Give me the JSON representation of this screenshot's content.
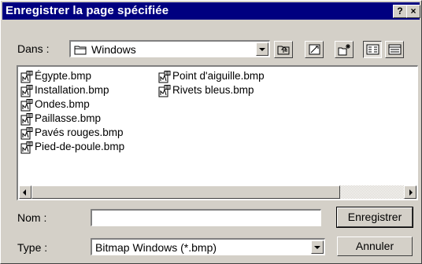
{
  "window": {
    "title": "Enregistrer la page spécifiée",
    "help_glyph": "?",
    "close_glyph": "×"
  },
  "location": {
    "label": "Dans :",
    "folder": "Windows",
    "folder_icon": "folder-icon"
  },
  "toolbar": {
    "buttons": [
      {
        "name": "up-one-level",
        "icon": "up-folder-icon"
      },
      {
        "name": "desktop",
        "icon": "desktop-icon"
      },
      {
        "name": "new-folder",
        "icon": "new-folder-icon"
      },
      {
        "name": "list-view",
        "icon": "list-view-icon",
        "pressed": true
      },
      {
        "name": "details-view",
        "icon": "details-view-icon"
      }
    ]
  },
  "files": {
    "icon": "bitmap-file-icon",
    "column1": [
      "Égypte.bmp",
      "Installation.bmp",
      "Ondes.bmp",
      "Paillasse.bmp",
      "Pavés rouges.bmp",
      "Pied-de-poule.bmp"
    ],
    "column2": [
      "Point d'aiguille.bmp",
      "Rivets bleus.bmp"
    ]
  },
  "filename": {
    "label": "Nom :",
    "value": ""
  },
  "filetype": {
    "label": "Type :",
    "selected": "Bitmap Windows (*.bmp)"
  },
  "buttons": {
    "save": "Enregistrer",
    "cancel": "Annuler"
  },
  "colors": {
    "titlebar": "#000080",
    "face": "#d4d0c8"
  }
}
